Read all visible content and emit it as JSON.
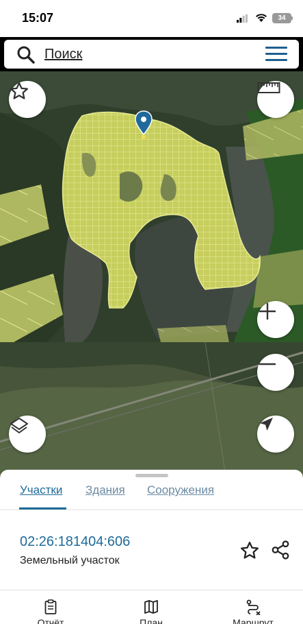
{
  "status_bar": {
    "time": "15:07",
    "battery": "34"
  },
  "search": {
    "placeholder": "Поиск"
  },
  "map": {
    "marker": "location-pin"
  },
  "sheet": {
    "tabs": [
      {
        "label": "Участки",
        "active": true
      },
      {
        "label": "Здания",
        "active": false
      },
      {
        "label": "Сооружения",
        "active": false
      }
    ],
    "parcel": {
      "number": "02:26:181404:606",
      "type": "Земельный участок"
    }
  },
  "bottom_nav": [
    {
      "label": "Отчёт",
      "icon": "clipboard-icon"
    },
    {
      "label": "План",
      "icon": "map-icon"
    },
    {
      "label": "Маршрут",
      "icon": "route-icon"
    }
  ],
  "colors": {
    "accent": "#1f6a9a",
    "parcel_fill": "#d9e26a",
    "parcel_stroke": "#f3f59a"
  }
}
